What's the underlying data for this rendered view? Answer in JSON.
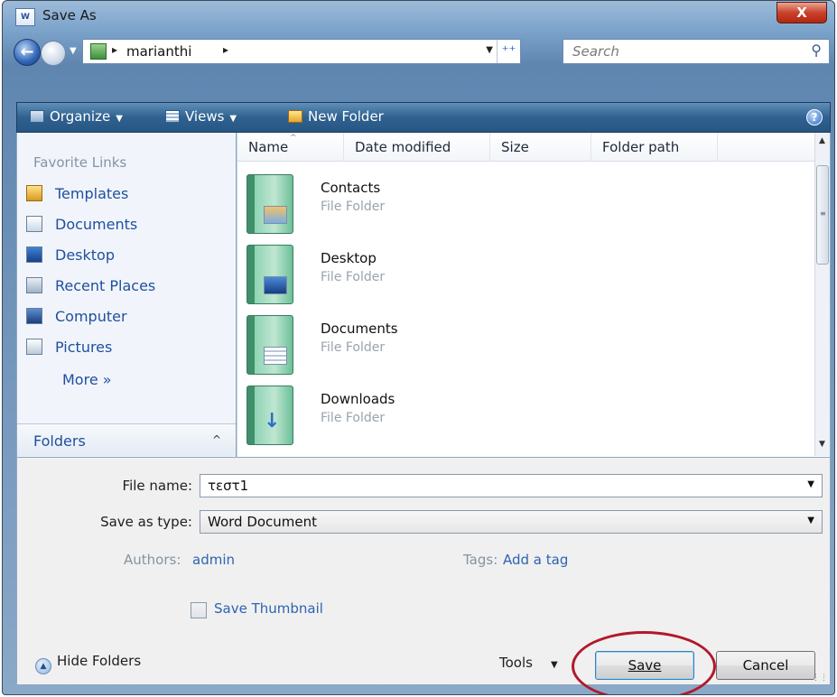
{
  "window": {
    "title": "Save As",
    "app_icon": "word-document-icon",
    "close_label": "X"
  },
  "nav": {
    "back_glyph": "←",
    "address": {
      "path_item": "marianthi",
      "separator": "▸",
      "dropdown": "▼",
      "refresh": "⁺⁺"
    },
    "search": {
      "placeholder": "Search",
      "icon": "search-icon"
    }
  },
  "toolbar": {
    "organize": "Organize",
    "views": "Views",
    "new_folder": "New Folder",
    "dropdown": "▼",
    "help": "?"
  },
  "favorites": {
    "title": "Favorite Links",
    "items": [
      {
        "label": "Templates",
        "icon": "templates-folder-icon"
      },
      {
        "label": "Documents",
        "icon": "documents-icon"
      },
      {
        "label": "Desktop",
        "icon": "desktop-icon"
      },
      {
        "label": "Recent Places",
        "icon": "recent-places-icon"
      },
      {
        "label": "Computer",
        "icon": "computer-icon"
      },
      {
        "label": "Pictures",
        "icon": "pictures-icon"
      }
    ],
    "more": "More  »",
    "folders_label": "Folders",
    "folders_toggle": "^"
  },
  "file_list": {
    "columns": [
      "Name",
      "Date modified",
      "Size",
      "Folder path"
    ],
    "sort_indicator": "^",
    "items": [
      {
        "name": "Contacts",
        "type": "File Folder"
      },
      {
        "name": "Desktop",
        "type": "File Folder"
      },
      {
        "name": "Documents",
        "type": "File Folder"
      },
      {
        "name": "Downloads",
        "type": "File Folder"
      }
    ]
  },
  "form": {
    "file_name_label": "File name:",
    "file_name_value": "τεστ1",
    "save_type_label": "Save as type:",
    "save_type_value": "Word Document",
    "authors_label": "Authors:",
    "authors_value": "admin",
    "tags_label": "Tags:",
    "tags_value": "Add a tag",
    "save_thumbnail_label": "Save Thumbnail",
    "hide_folders_label": "Hide Folders",
    "tools_label": "Tools",
    "save_label": "Save",
    "cancel_label": "Cancel"
  },
  "colors": {
    "accent": "#1f4f9e",
    "highlight_ring": "#b0192b",
    "toolbar": "#2f6190"
  }
}
